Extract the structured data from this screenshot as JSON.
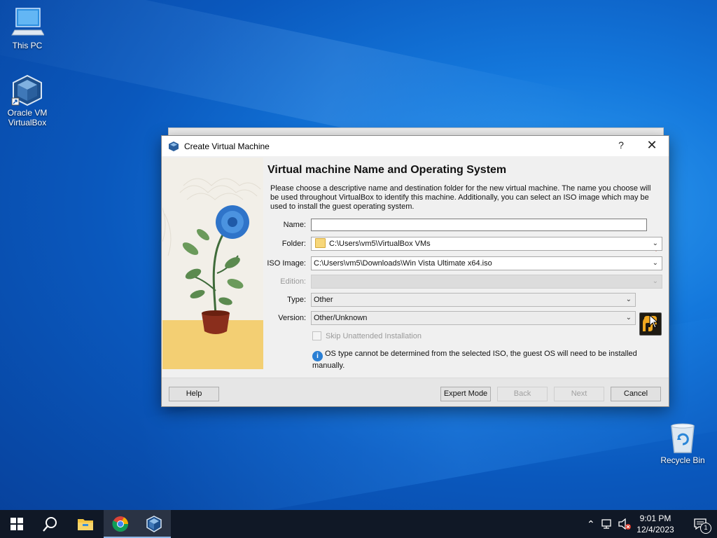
{
  "desktop": {
    "icons": [
      {
        "label": "This PC"
      },
      {
        "label": "Oracle VM VirtualBox"
      },
      {
        "label": "Recycle Bin"
      }
    ]
  },
  "dialog": {
    "title": "Create Virtual Machine",
    "help_glyph": "?",
    "close_glyph": "✕",
    "heading": "Virtual machine Name and Operating System",
    "description": "Please choose a descriptive name and destination folder for the new virtual machine. The name you choose will be used throughout VirtualBox to identify this machine. Additionally, you can select an ISO image which may be used to install the guest operating system.",
    "name": {
      "label": "Name:",
      "value": ""
    },
    "folder": {
      "label": "Folder:",
      "value": "C:\\Users\\vm5\\VirtualBox VMs"
    },
    "iso": {
      "label": "ISO Image:",
      "value": "C:\\Users\\vm5\\Downloads\\Win Vista Ultimate x64.iso"
    },
    "edition": {
      "label": "Edition:",
      "value": ""
    },
    "type": {
      "label": "Type:",
      "value": "Other"
    },
    "version": {
      "label": "Version:",
      "value": "Other/Unknown"
    },
    "skip_unattended": {
      "label": "Skip Unattended Installation",
      "checked": false,
      "enabled": false
    },
    "info_note": "OS type cannot be determined from the selected ISO, the guest OS will need to be installed manually.",
    "buttons": {
      "help": "Help",
      "expert": "Expert Mode",
      "back": "Back",
      "next": "Next",
      "cancel": "Cancel"
    }
  },
  "taskbar": {
    "time": "9:01 PM",
    "date": "12/4/2023",
    "notification_count": "1"
  },
  "colors": {
    "desktop_blue": "#0a58bd",
    "taskbar": "#101826",
    "dialog_bg": "#f0f0f0",
    "warning": "#e8502a",
    "info": "#2a7fd4"
  }
}
